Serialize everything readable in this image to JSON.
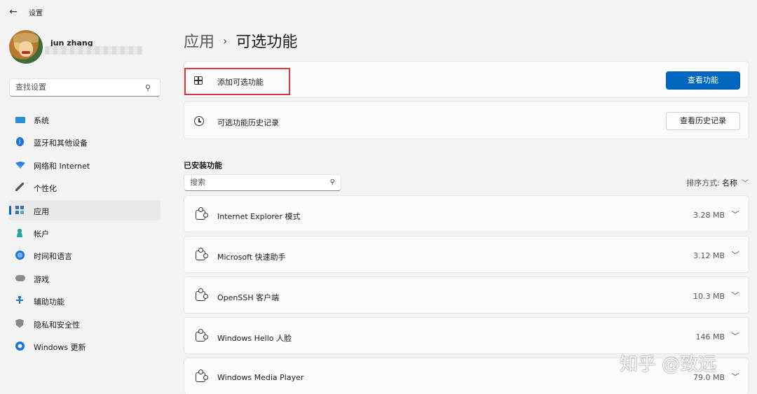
{
  "window": {
    "title": "设置"
  },
  "profile": {
    "name": "jun zhang"
  },
  "sidebar": {
    "search_placeholder": "查找设置",
    "items": [
      {
        "label": "系统",
        "icon": "monitor-icon"
      },
      {
        "label": "蓝牙和其他设备",
        "icon": "bluetooth-icon"
      },
      {
        "label": "网络和 Internet",
        "icon": "wifi-icon"
      },
      {
        "label": "个性化",
        "icon": "pen-icon"
      },
      {
        "label": "应用",
        "icon": "apps-icon",
        "active": true
      },
      {
        "label": "帐户",
        "icon": "person-icon"
      },
      {
        "label": "时间和语言",
        "icon": "globe-clock-icon"
      },
      {
        "label": "游戏",
        "icon": "gamepad-icon"
      },
      {
        "label": "辅助功能",
        "icon": "accessibility-icon"
      },
      {
        "label": "隐私和安全性",
        "icon": "shield-icon"
      },
      {
        "label": "Windows 更新",
        "icon": "update-icon"
      }
    ]
  },
  "header": {
    "parent": "应用",
    "separator": "›",
    "current": "可选功能"
  },
  "add_feature": {
    "label": "添加可选功能",
    "button": "查看功能"
  },
  "history": {
    "label": "可选功能历史记录",
    "button": "查看历史记录"
  },
  "installed": {
    "title": "已安装功能",
    "search_placeholder": "搜索",
    "sort_label": "排序方式:",
    "sort_value": "名称",
    "features": [
      {
        "name": "Internet Explorer 模式",
        "size": "3.28 MB"
      },
      {
        "name": "Microsoft 快速助手",
        "size": "3.12 MB"
      },
      {
        "name": "OpenSSH 客户端",
        "size": "10.3 MB"
      },
      {
        "name": "Windows Hello 人脸",
        "size": "146 MB"
      },
      {
        "name": "Windows Media Player",
        "size": "79.0 MB"
      }
    ]
  },
  "watermark": "知乎 @致远",
  "colors": {
    "accent": "#0067c0",
    "highlight": "#d9363e",
    "background": "#f3f3f3"
  }
}
